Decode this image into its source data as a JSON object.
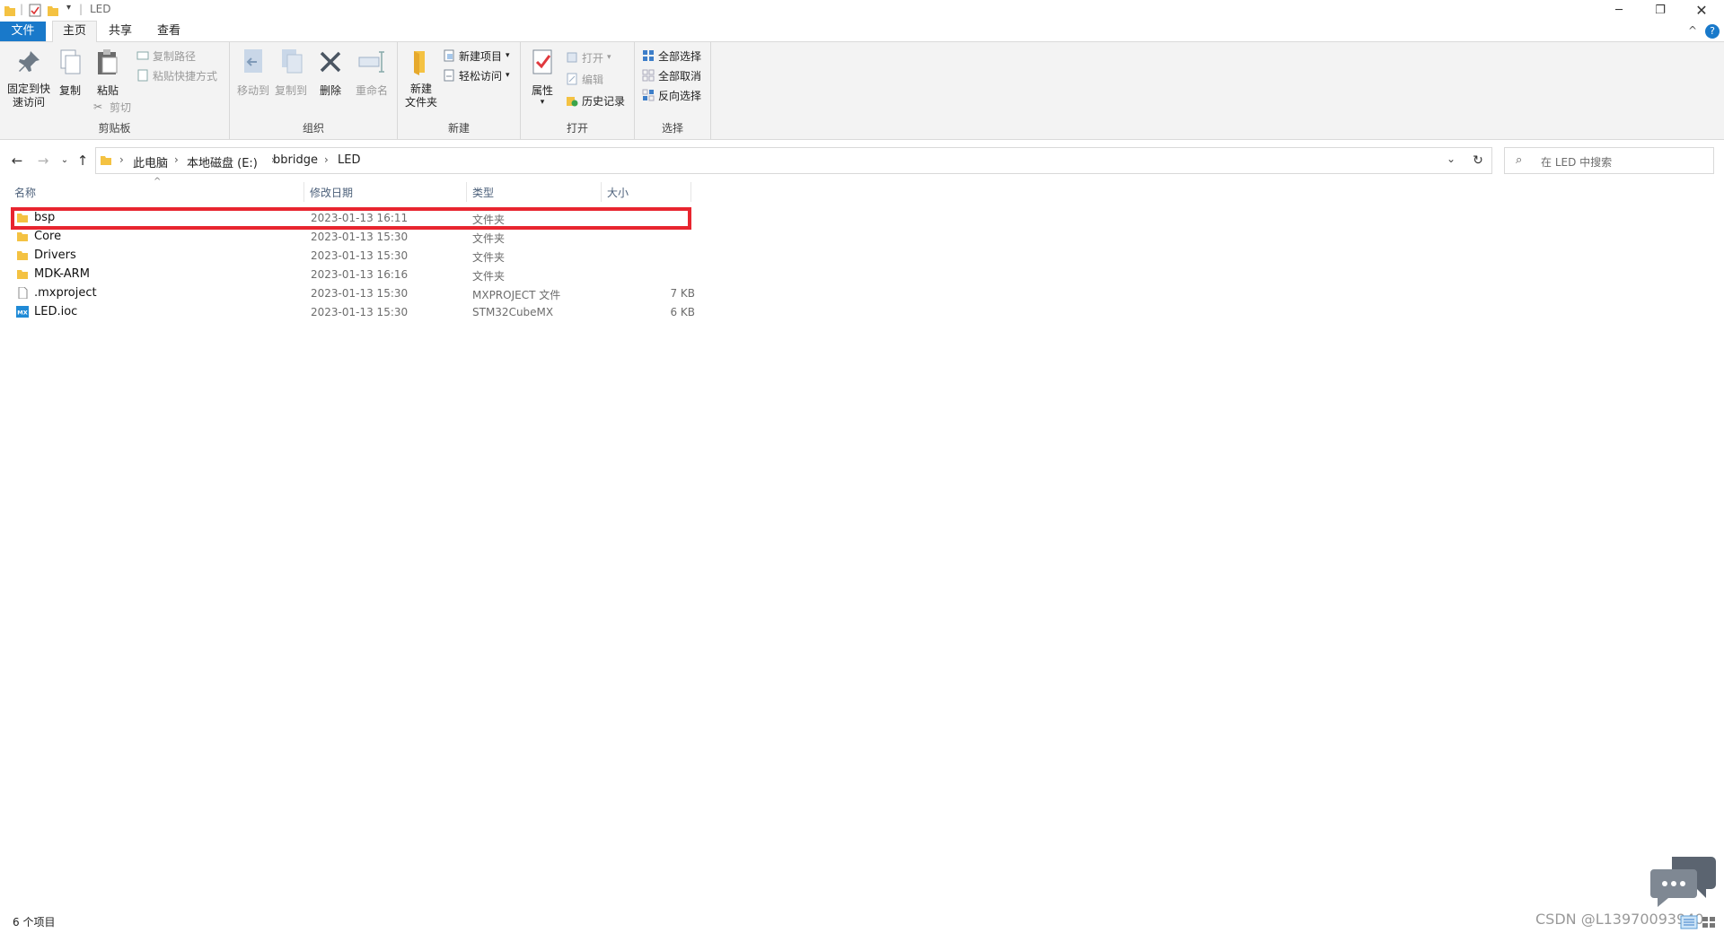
{
  "window": {
    "title": "LED"
  },
  "ribbon_tabs": [
    {
      "label": "文件"
    },
    {
      "label": "主页"
    },
    {
      "label": "共享"
    },
    {
      "label": "查看"
    }
  ],
  "ribbon": {
    "clipboard": {
      "label": "剪贴板",
      "pin": "固定到快\n速访问",
      "copy": "复制",
      "paste": "粘贴",
      "copy_path": "复制路径",
      "paste_shortcut": "粘贴快捷方式",
      "cut": "剪切"
    },
    "organize": {
      "label": "组织",
      "move_to": "移动到",
      "copy_to": "复制到",
      "delete": "删除",
      "rename": "重命名"
    },
    "new": {
      "label": "新建",
      "new_folder": "新建\n文件夹",
      "new_item": "新建项目",
      "easy_access": "轻松访问"
    },
    "open": {
      "label": "打开",
      "properties": "属性",
      "open": "打开",
      "edit": "编辑",
      "history": "历史记录"
    },
    "select": {
      "label": "选择",
      "select_all": "全部选择",
      "select_none": "全部取消",
      "invert": "反向选择"
    }
  },
  "address": {
    "crumbs": [
      "此电脑",
      "本地磁盘 (E:)",
      "bbridge",
      "LED"
    ]
  },
  "search": {
    "placeholder": "在 LED 中搜索"
  },
  "columns": {
    "name": "名称",
    "date": "修改日期",
    "type": "类型",
    "size": "大小"
  },
  "files": [
    {
      "name": "bsp",
      "date": "2023-01-13 16:11",
      "type": "文件夹",
      "size": "",
      "icon": "folder"
    },
    {
      "name": "Core",
      "date": "2023-01-13 15:30",
      "type": "文件夹",
      "size": "",
      "icon": "folder"
    },
    {
      "name": "Drivers",
      "date": "2023-01-13 15:30",
      "type": "文件夹",
      "size": "",
      "icon": "folder"
    },
    {
      "name": "MDK-ARM",
      "date": "2023-01-13 16:16",
      "type": "文件夹",
      "size": "",
      "icon": "folder"
    },
    {
      "name": ".mxproject",
      "date": "2023-01-13 15:30",
      "type": "MXPROJECT 文件",
      "size": "7 KB",
      "icon": "file"
    },
    {
      "name": "LED.ioc",
      "date": "2023-01-13 15:30",
      "type": "STM32CubeMX",
      "size": "6 KB",
      "icon": "mx-file"
    }
  ],
  "status": {
    "count": "6 个项目"
  },
  "watermark": "CSDN @L13970093940",
  "colors": {
    "file_tab": "#1979ca",
    "highlight": "#e8252f",
    "folder": "#f4c242"
  }
}
